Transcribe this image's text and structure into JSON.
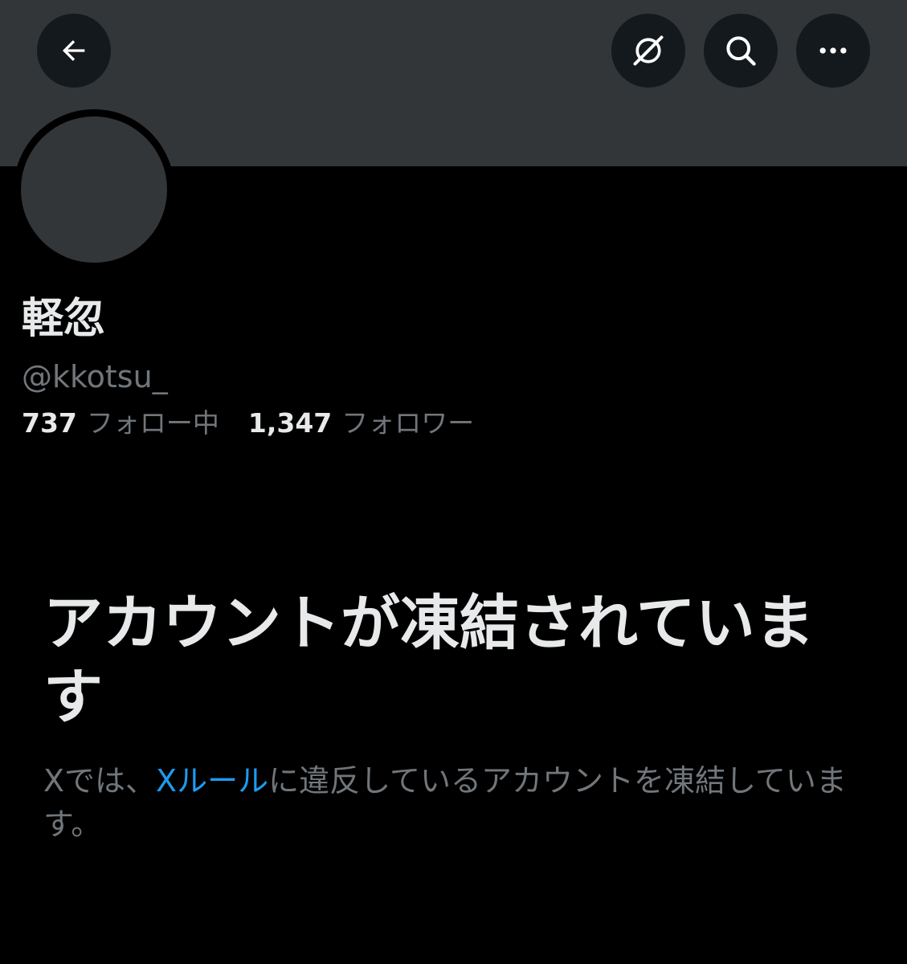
{
  "header": {
    "back_icon": "arrow-left-icon",
    "grok_icon": "grok-icon",
    "search_icon": "search-icon",
    "more_icon": "more-horizontal-icon"
  },
  "profile": {
    "display_name": "軽忽",
    "handle": "@kkotsu_",
    "following_count": "737",
    "following_label": "フォロー中",
    "followers_count": "1,347",
    "followers_label": "フォロワー"
  },
  "suspension": {
    "title": "アカウントが凍結されています",
    "desc_before": "Xでは、",
    "rules_link": "Xルール",
    "desc_after": "に違反しているアカウントを凍結しています。"
  },
  "colors": {
    "background": "#000000",
    "banner": "#333639",
    "primary_text": "#e7e9ea",
    "secondary_text": "#71767b",
    "link": "#1d9bf0"
  }
}
